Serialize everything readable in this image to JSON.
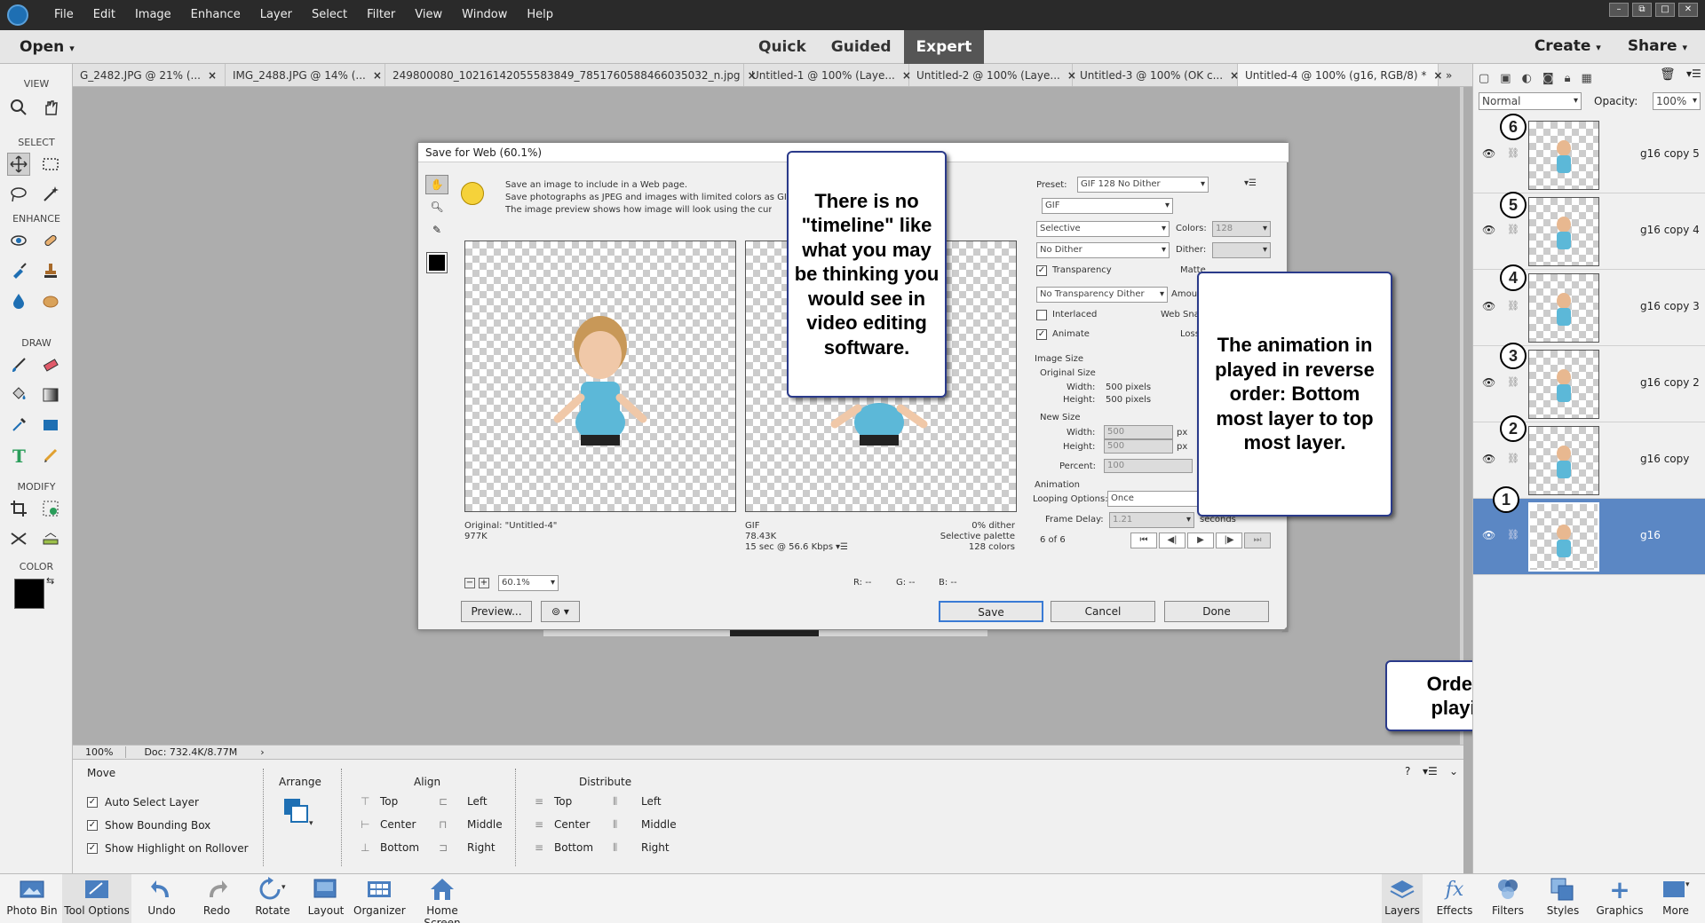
{
  "menubar": {
    "items": [
      "File",
      "Edit",
      "Image",
      "Enhance",
      "Layer",
      "Select",
      "Filter",
      "View",
      "Window",
      "Help"
    ],
    "window_controls": [
      "–",
      "⧉",
      "□",
      "✕"
    ]
  },
  "modebar": {
    "open_label": "Open",
    "modes": [
      "Quick",
      "Guided",
      "Expert"
    ],
    "active_mode": "Expert",
    "create_label": "Create",
    "share_label": "Share"
  },
  "tabs": [
    {
      "label": "G_2482.JPG @ 21% (..."
    },
    {
      "label": "IMG_2488.JPG @ 14% (..."
    },
    {
      "label": "249800080_10216142055583849_7851760588466035032_n.jpg"
    },
    {
      "label": "Untitled-1 @ 100% (Laye..."
    },
    {
      "label": "Untitled-2 @ 100% (Laye..."
    },
    {
      "label": "Untitled-3 @ 100% (OK c..."
    },
    {
      "label": "Untitled-4 @ 100% (g16, RGB/8) *"
    }
  ],
  "toolbox": {
    "sections": [
      "VIEW",
      "SELECT",
      "ENHANCE",
      "DRAW",
      "MODIFY",
      "COLOR"
    ]
  },
  "status": {
    "zoom": "100%",
    "doc": "Doc: 732.4K/8.77M"
  },
  "dialog": {
    "title": "Save for Web (60.1%)",
    "tip_line1": "Save an image to include in a Web page.",
    "tip_line2": "Save photographs as JPEG and images with limited colors as GIF.",
    "tip_line3": "The image preview shows how image will look using the current se",
    "original_label": "Original: \"Untitled-4\"",
    "original_size": "977K",
    "opt_format": "GIF",
    "opt_size": "78.43K",
    "opt_time": "15 sec @ 56.6 Kbps",
    "opt_dither": "0% dither",
    "opt_palette": "Selective palette",
    "opt_colors": "128 colors",
    "zoom_value": "60.1%",
    "r_label": "R: --",
    "g_label": "G: --",
    "b_label": "B: --",
    "preview_button": "Preview...",
    "save_button": "Save",
    "cancel_button": "Cancel",
    "done_button": "Done",
    "preset_label": "Preset:",
    "preset_value": "GIF 128 No Dither",
    "format_value": "GIF",
    "reduction_value": "Selective",
    "colors_label": "Colors:",
    "colors_value": "128",
    "dither_value": "No Dither",
    "dither_label": "Dither:",
    "transparency_label": "Transparency",
    "matte_label": "Matte",
    "trans_dither_value": "No Transparency Dither",
    "amount_label": "Amoun",
    "interlaced_label": "Interlaced",
    "websnap_label": "Web Snap",
    "animate_label": "Animate",
    "lossy_label": "Lossy",
    "image_size_label": "Image Size",
    "original_size_label": "Original Size",
    "width_label": "Width:",
    "width_value": "500 pixels",
    "height_label": "Height:",
    "height_value": "500 pixels",
    "new_size_label": "New Size",
    "new_width_value": "500",
    "new_height_value": "500",
    "px_label": "px",
    "percent_label": "Percent:",
    "percent_value": "100",
    "animation_label": "Animation",
    "looping_label": "Looping Options:",
    "looping_value": "Once",
    "frame_delay_label": "Frame Delay:",
    "frame_delay_value": "1.21",
    "seconds_label": "seconds",
    "frame_count": "6 of 6"
  },
  "callouts": {
    "timeline": "There is no \"timeline\" like what you may be thinking you would see in video editing software.",
    "reverse": "The animation in played in reverse order: Bottom most layer to top most layer.",
    "order": "Order of playing"
  },
  "layers_panel": {
    "blend_mode": "Normal",
    "opacity_label": "Opacity:",
    "opacity_value": "100%",
    "layers": [
      {
        "name": "g16 copy 5",
        "order": "6"
      },
      {
        "name": "g16 copy 4",
        "order": "5"
      },
      {
        "name": "g16 copy 3",
        "order": "4"
      },
      {
        "name": "g16 copy 2",
        "order": "3"
      },
      {
        "name": "g16 copy",
        "order": "2"
      },
      {
        "name": "g16",
        "order": "1"
      }
    ]
  },
  "tool_options": {
    "tool_name": "Move",
    "auto_select": "Auto Select Layer",
    "bounding_box": "Show Bounding Box",
    "highlight": "Show Highlight on Rollover",
    "arrange_label": "Arrange",
    "align_label": "Align",
    "distribute_label": "Distribute",
    "align_items": [
      "Top",
      "Center",
      "Bottom",
      "Left",
      "Middle",
      "Right"
    ],
    "distribute_items": [
      "Top",
      "Center",
      "Bottom",
      "Left",
      "Middle",
      "Right"
    ]
  },
  "bottombar": {
    "left": [
      "Photo Bin",
      "Tool Options",
      "Undo",
      "Redo",
      "Rotate",
      "Layout",
      "Organizer",
      "Home Screen"
    ],
    "right": [
      "Layers",
      "Effects",
      "Filters",
      "Styles",
      "Graphics",
      "More"
    ]
  },
  "colors": {
    "accent": "#3a7bd5",
    "active_layer": "#5b87c4",
    "menubar_bg": "#2a2a2a",
    "callout_border": "#2a3a8a"
  }
}
